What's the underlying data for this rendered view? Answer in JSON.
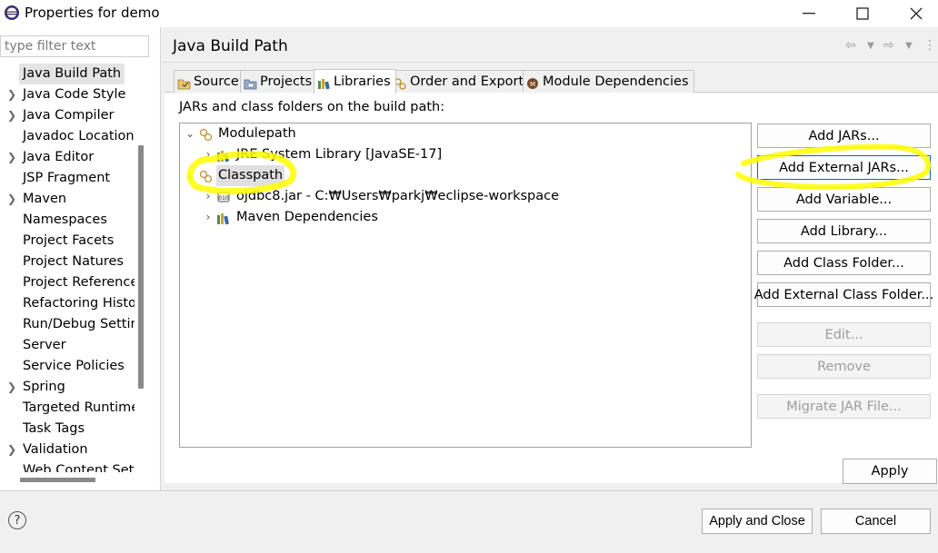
{
  "window": {
    "title": "Properties for demo",
    "minimize_icon": "minimize-icon",
    "maximize_icon": "maximize-icon",
    "close_icon": "close-icon"
  },
  "sidebar": {
    "filter_placeholder": "type filter text",
    "items": [
      {
        "label": "Java Build Path",
        "expandable": false,
        "selected": true
      },
      {
        "label": "Java Code Style",
        "expandable": true
      },
      {
        "label": "Java Compiler",
        "expandable": true
      },
      {
        "label": "Javadoc Location",
        "expandable": false
      },
      {
        "label": "Java Editor",
        "expandable": true
      },
      {
        "label": "JSP Fragment",
        "expandable": false
      },
      {
        "label": "Maven",
        "expandable": true
      },
      {
        "label": "Namespaces",
        "expandable": false
      },
      {
        "label": "Project Facets",
        "expandable": false
      },
      {
        "label": "Project Natures",
        "expandable": false
      },
      {
        "label": "Project Reference",
        "expandable": false
      },
      {
        "label": "Refactoring Histor",
        "expandable": false
      },
      {
        "label": "Run/Debug Settin",
        "expandable": false
      },
      {
        "label": "Server",
        "expandable": false
      },
      {
        "label": "Service Policies",
        "expandable": false
      },
      {
        "label": "Spring",
        "expandable": true
      },
      {
        "label": "Targeted Runtime",
        "expandable": false
      },
      {
        "label": "Task Tags",
        "expandable": false
      },
      {
        "label": "Validation",
        "expandable": true
      },
      {
        "label": "Web Content Sett",
        "expandable": false
      }
    ]
  },
  "main": {
    "title": "Java Build Path",
    "tabs": [
      {
        "label": "Source",
        "icon": "source-folder-icon"
      },
      {
        "label": "Projects",
        "icon": "projects-icon"
      },
      {
        "label": "Libraries",
        "icon": "libraries-icon",
        "active": true
      },
      {
        "label": "Order and Export",
        "icon": "order-export-icon"
      },
      {
        "label": "Module Dependencies",
        "icon": "module-icon"
      }
    ],
    "description": "JARs and class folders on the build path:",
    "build_path": {
      "modulepath": "Modulepath",
      "jre": "JRE System Library [JavaSE-17]",
      "classpath": "Classpath",
      "ojdbc": "ojdbc8.jar - C:₩Users₩parkj₩eclipse-workspace",
      "maven": "Maven Dependencies"
    },
    "buttons": {
      "add_jars": "Add JARs...",
      "add_external_jars": "Add External JARs...",
      "add_variable": "Add Variable...",
      "add_library": "Add Library...",
      "add_class_folder": "Add Class Folder...",
      "add_external_class_folder": "Add External Class Folder...",
      "edit": "Edit...",
      "remove": "Remove",
      "migrate_jar": "Migrate JAR File..."
    },
    "apply": "Apply"
  },
  "footer": {
    "help_icon": "help-icon",
    "apply_and_close": "Apply and Close",
    "cancel": "Cancel"
  },
  "colors": {
    "highlight": "#ffff00",
    "selection": "#e0e0e0"
  }
}
